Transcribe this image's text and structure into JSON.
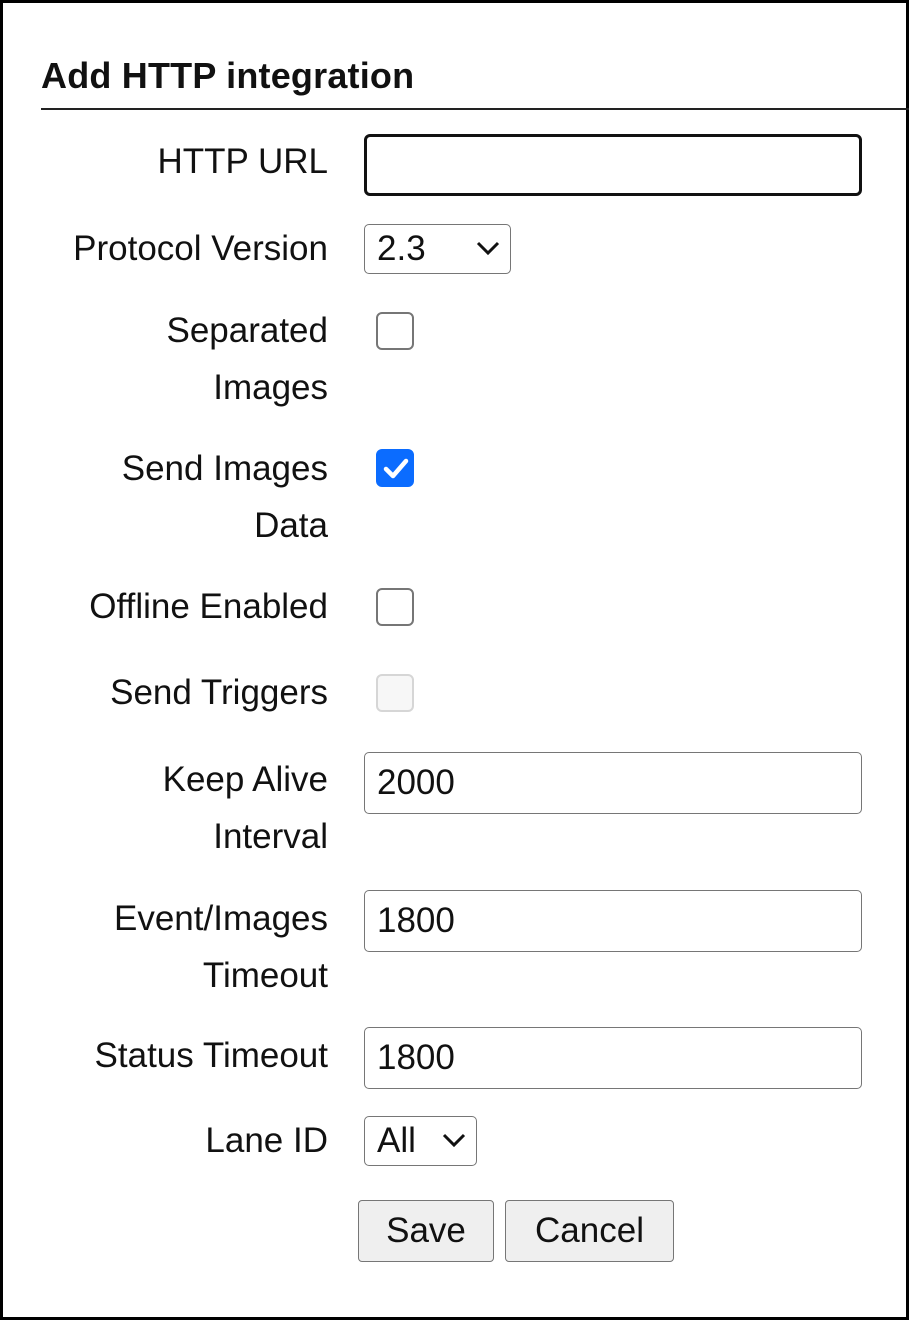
{
  "form": {
    "title": "Add HTTP integration",
    "http_url": {
      "label": "HTTP URL",
      "value": ""
    },
    "protocol_version": {
      "label": "Protocol Version",
      "selected": "2.3"
    },
    "separated_images": {
      "label_line1": "Separated",
      "label_line2": "Images",
      "checked": false
    },
    "send_images_data": {
      "label_line1": "Send Images",
      "label_line2": "Data",
      "checked": true
    },
    "offline_enabled": {
      "label": "Offline Enabled",
      "checked": false
    },
    "send_triggers": {
      "label": "Send Triggers",
      "checked": false,
      "disabled": true
    },
    "keep_alive_interval": {
      "label_line1": "Keep Alive",
      "label_line2": "Interval",
      "value": "2000"
    },
    "event_images_timeout": {
      "label_line1": "Event/Images",
      "label_line2": "Timeout",
      "value": "1800"
    },
    "status_timeout": {
      "label": "Status Timeout",
      "value": "1800"
    },
    "lane_id": {
      "label": "Lane ID",
      "selected": "All"
    },
    "save_label": "Save",
    "cancel_label": "Cancel"
  },
  "colors": {
    "checkbox_checked": "#0b6cff",
    "button_bg": "#efefef",
    "border": "#767676"
  }
}
